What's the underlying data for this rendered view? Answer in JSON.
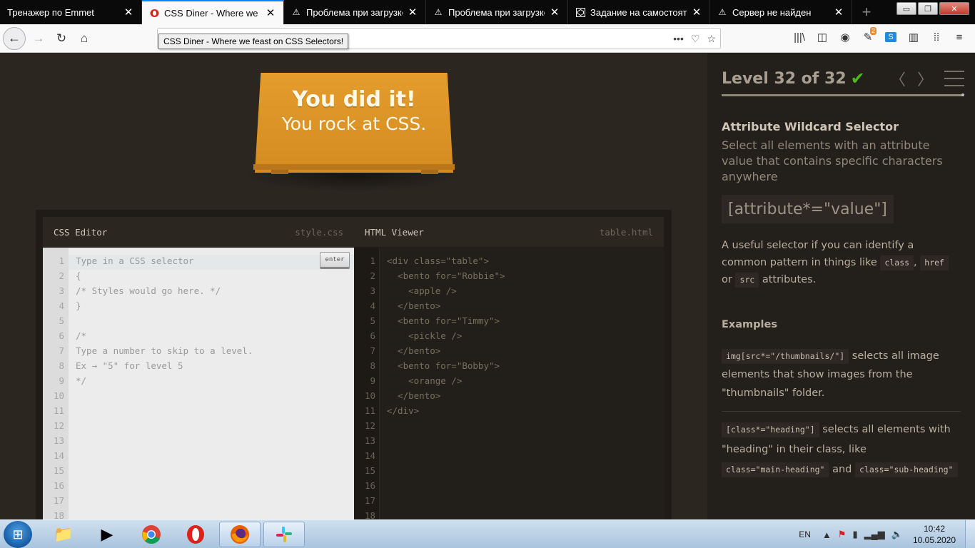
{
  "browser": {
    "tabs": [
      {
        "title": "Тренажер по Emmet",
        "icon": "none",
        "active": false
      },
      {
        "title": "CSS Diner - Where we feast",
        "icon": "opera-red-icon",
        "active": true
      },
      {
        "title": "Проблема при загрузке ст",
        "icon": "warning-icon",
        "active": false
      },
      {
        "title": "Проблема при загрузке ст",
        "icon": "warning-icon",
        "active": false
      },
      {
        "title": "Задание на самостоятельн",
        "icon": "codepen-icon",
        "active": false
      },
      {
        "title": "Сервер не найден",
        "icon": "warning-icon",
        "active": false
      }
    ],
    "tooltip": "CSS Diner - Where we feast on CSS Selectors!",
    "sync_badge": "2",
    "window_controls": [
      "▭",
      "❐",
      "✕"
    ]
  },
  "page": {
    "sign": {
      "line1": "You did it!",
      "line2": "You rock at CSS."
    },
    "css_editor": {
      "title": "CSS Editor",
      "filename": "style.css",
      "enter_label": "enter",
      "line_numbers": [
        "1",
        "2",
        "3",
        "4",
        "5",
        "6",
        "7",
        "8",
        "9",
        "10",
        "11",
        "12",
        "13",
        "14",
        "15",
        "16",
        "17",
        "18"
      ],
      "lines": [
        "Type in a CSS selector",
        "{",
        "/* Styles would go here. */",
        "}",
        "",
        "/*",
        "Type a number to skip to a level.",
        "Ex → \"5\" for level 5",
        "*/"
      ]
    },
    "html_viewer": {
      "title": "HTML Viewer",
      "filename": "table.html",
      "line_numbers": [
        "1",
        "2",
        "3",
        "4",
        "5",
        "6",
        "7",
        "8",
        "9",
        "10",
        "11",
        "12",
        "13",
        "14",
        "15",
        "16",
        "17",
        "18"
      ],
      "lines": [
        "<div class=\"table\">",
        "  <bento for=\"Robbie\">",
        "    <apple />",
        "  </bento>",
        "  <bento for=\"Timmy\">",
        "    <pickle />",
        "  </bento>",
        "  <bento for=\"Bobby\">",
        "    <orange />",
        "  </bento>",
        "</div>"
      ]
    },
    "sidebar": {
      "level_title": "Level 32 of 32",
      "check": "✔",
      "selector_name": "Attribute Wildcard Selector",
      "selector_desc": "Select all elements with an attribute value that contains specific characters anywhere",
      "syntax": "[attribute*=\"value\"]",
      "help_prefix": "A useful selector if you can identify a common pattern in things like",
      "help_codes": [
        "class",
        "href",
        "src"
      ],
      "help_or": "or",
      "help_suffix": "attributes.",
      "examples_title": "Examples",
      "example1_code": "img[src*=\"/thumbnails/\"]",
      "example1_text": "selects all image elements that show images from the \"thumbnails\" folder.",
      "example2_code": "[class*=\"heading\"]",
      "example2_text": "selects all elements with \"heading\" in their class, like",
      "example2_code2": "class=\"main-heading\"",
      "example2_and": "and",
      "example2_code3": "class=\"sub-heading\""
    }
  },
  "taskbar": {
    "lang": "EN",
    "time": "10:42",
    "date": "10.05.2020"
  }
}
